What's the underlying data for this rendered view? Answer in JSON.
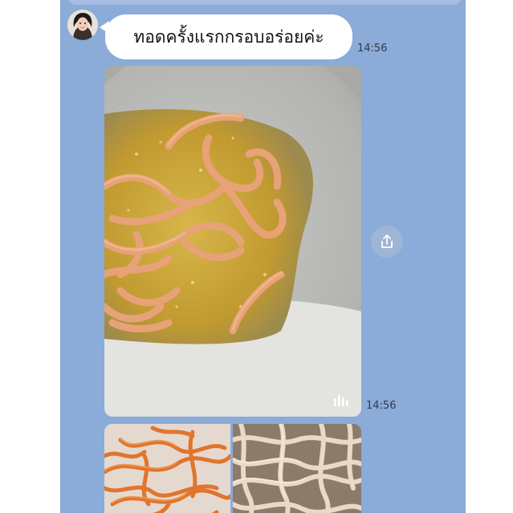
{
  "chat": {
    "messages": [
      {
        "type": "text",
        "text": "ทอดครั้งแรกกรอบอร่อยค่ะ",
        "time": "14:56"
      },
      {
        "type": "photo",
        "time": "14:56",
        "icon": "video-bars-icon"
      },
      {
        "type": "photo-grid",
        "count": 2
      }
    ],
    "share_icon": "share-icon"
  },
  "colors": {
    "chat_background": "#8babd8",
    "bubble": "#ffffff",
    "oil": "#c8a43a",
    "noodle": "#e8a277"
  }
}
